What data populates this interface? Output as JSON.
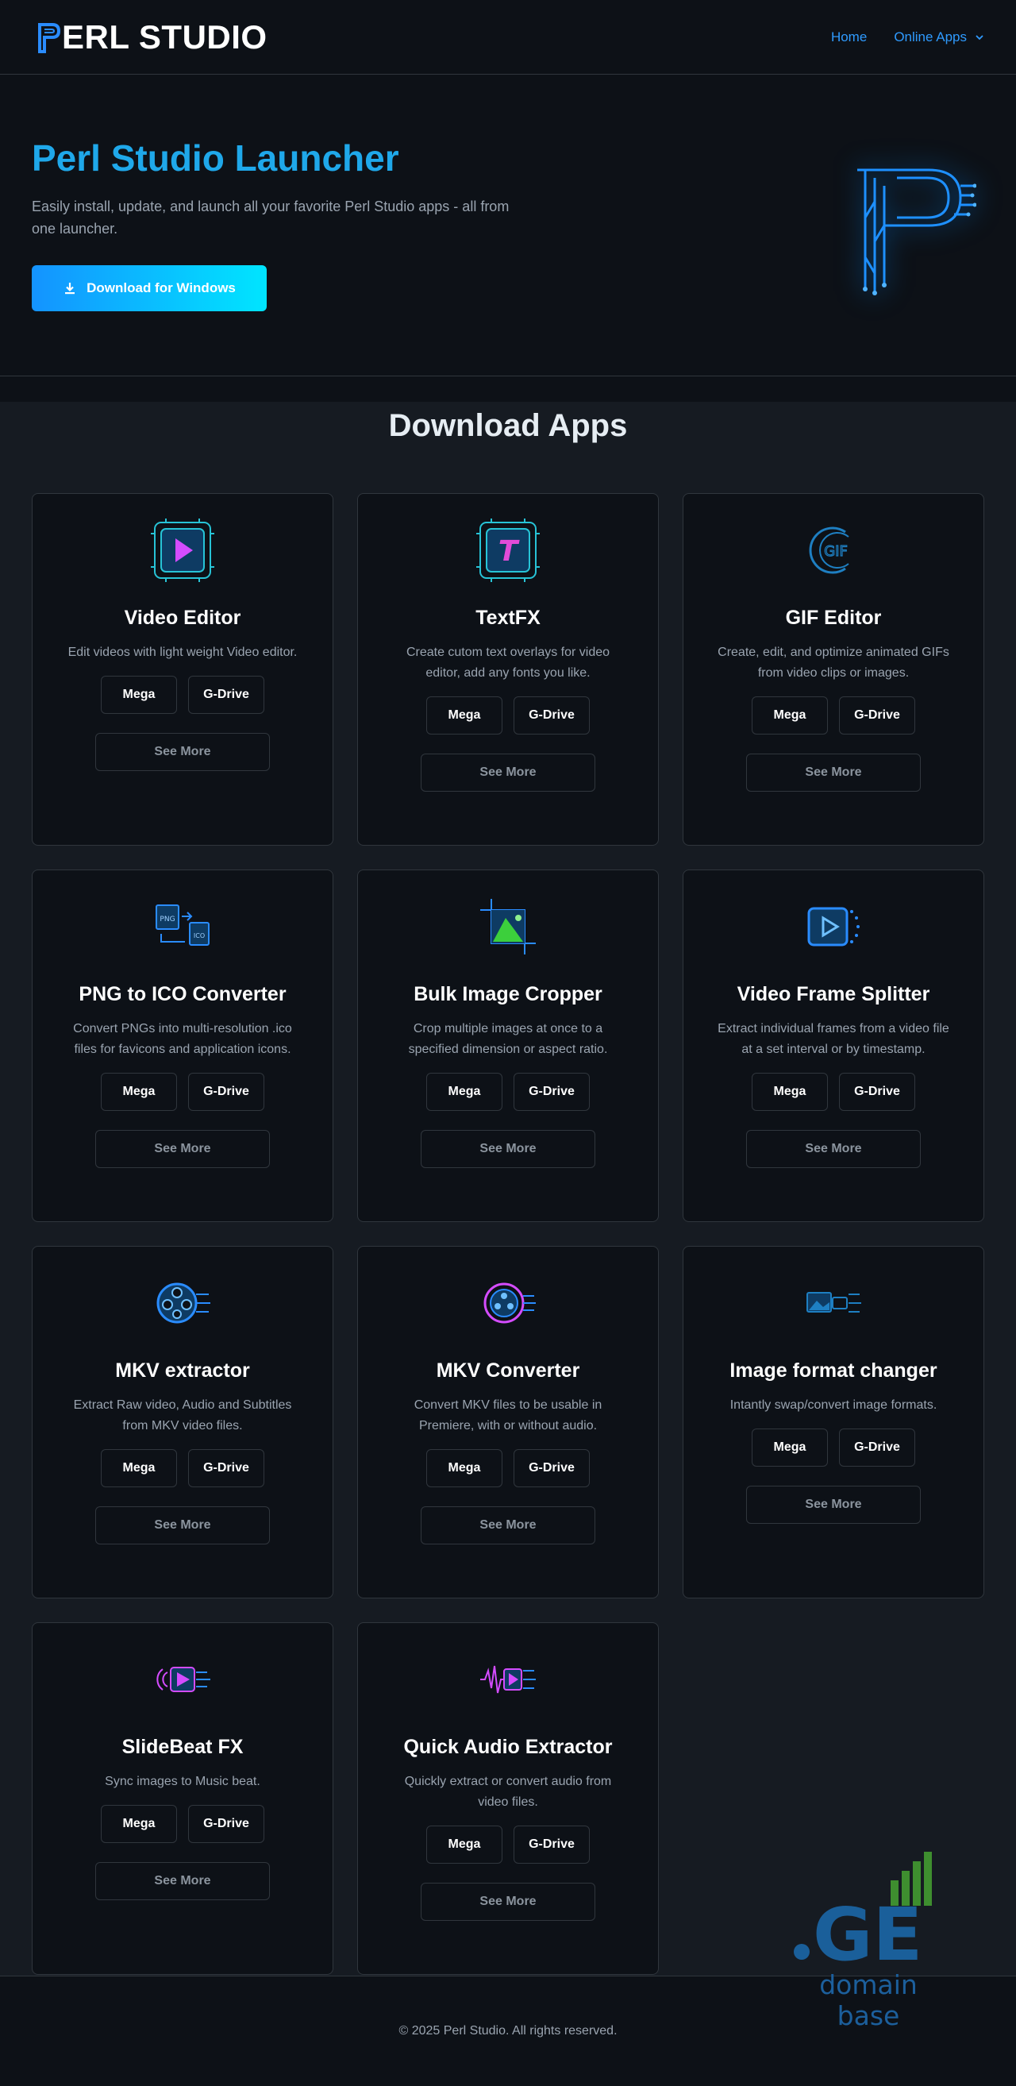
{
  "header": {
    "logo_text": "ERL STUDIO",
    "nav": {
      "home": "Home",
      "online_apps": "Online Apps"
    }
  },
  "hero": {
    "title": "Perl Studio Launcher",
    "subtitle": "Easily install, update, and launch all your favorite Perl Studio apps - all from one launcher.",
    "download_label": "Download for Windows"
  },
  "apps_section": {
    "title": "Download Apps",
    "mega_label": "Mega",
    "gdrive_label": "G-Drive",
    "see_more_label": "See More",
    "apps": [
      {
        "name": "Video Editor",
        "description": "Edit videos with light weight Video editor.",
        "icon": "video-editor-icon"
      },
      {
        "name": "TextFX",
        "description": "Create cutom text overlays for video editor, add any fonts you like.",
        "icon": "textfx-icon"
      },
      {
        "name": "GIF Editor",
        "description": "Create, edit, and optimize animated GIFs from video clips or images.",
        "icon": "gif-icon"
      },
      {
        "name": "PNG to ICO Converter",
        "description": "Convert PNGs into multi-resolution .ico files for favicons and application icons.",
        "icon": "png-ico-icon"
      },
      {
        "name": "Bulk Image Cropper",
        "description": "Crop multiple images at once to a specified dimension or aspect ratio.",
        "icon": "crop-icon"
      },
      {
        "name": "Video Frame Splitter",
        "description": "Extract individual frames from a video file at a set interval or by timestamp.",
        "icon": "frame-splitter-icon"
      },
      {
        "name": "MKV extractor",
        "description": "Extract Raw video, Audio and Subtitles from MKV video files.",
        "icon": "film-reel-icon"
      },
      {
        "name": "MKV Converter",
        "description": "Convert MKV files to be usable in Premiere, with or without audio.",
        "icon": "mkv-converter-icon"
      },
      {
        "name": "Image format changer",
        "description": "Intantly swap/convert image formats.",
        "icon": "image-format-icon"
      },
      {
        "name": "SlideBeat FX",
        "description": "Sync images to Music beat.",
        "icon": "slidebeat-icon"
      },
      {
        "name": "Quick Audio Extractor",
        "description": "Quickly extract or convert audio from video files.",
        "icon": "audio-extractor-icon"
      }
    ]
  },
  "footer": {
    "copyright": "© 2025 Perl Studio. All rights reserved."
  },
  "watermark": {
    "text": "domain base"
  },
  "colors": {
    "accent": "#1fa8ea",
    "nav_link": "#2f9bff",
    "background": "#0d1117",
    "section_bg": "#161b22",
    "border": "#30363d"
  }
}
